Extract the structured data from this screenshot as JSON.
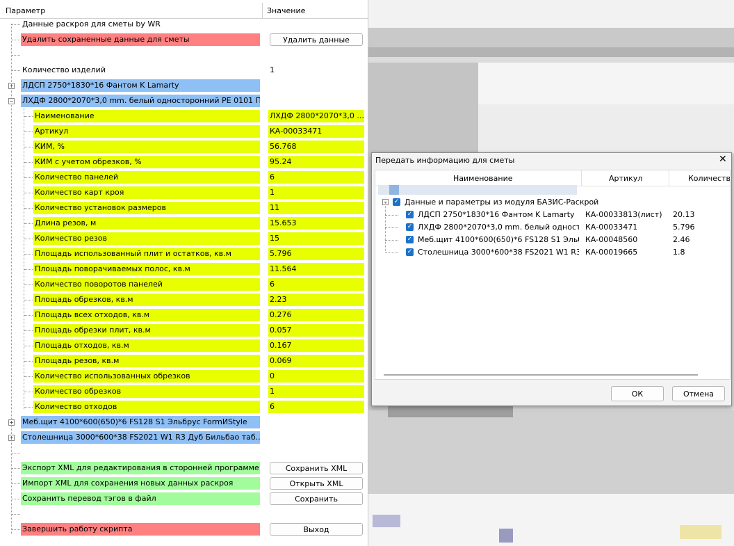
{
  "panel": {
    "col_param": "Параметр",
    "col_value": "Значение",
    "title_row": "Данные раскроя для сметы by WR",
    "delete_saved": {
      "label": "Удалить сохраненные данные для сметы",
      "button": "Удалить данные"
    },
    "count_items": {
      "label": "Количество изделий",
      "value": "1"
    },
    "materials": [
      {
        "label": "ЛДСП 2750*1830*16 Фантом K Lamarty",
        "expander": "+"
      },
      {
        "label": "ЛХДФ 2800*2070*3,0 mm. белый односторонний PE 0101 П",
        "expander": "−"
      },
      {
        "label": "Меб.щит 4100*600(650)*6 FS128 S1 Эльбрус FormИStyle",
        "expander": "+"
      },
      {
        "label": "Столешница 3000*600*38 FS2021 W1 R3 Дуб Бильбао таб...",
        "expander": "+"
      }
    ],
    "props": [
      {
        "label": "Наименование",
        "value": "ЛХДФ 2800*2070*3,0 ..."
      },
      {
        "label": "Артикул",
        "value": "КА-00033471"
      },
      {
        "label": "КИМ, %",
        "value": "56.768"
      },
      {
        "label": "КИМ с учетом обрезков, %",
        "value": "95.24"
      },
      {
        "label": "Количество панелей",
        "value": "6"
      },
      {
        "label": "Количество карт кроя",
        "value": "1"
      },
      {
        "label": "Количество установок размеров",
        "value": "11"
      },
      {
        "label": "Длина резов, м",
        "value": "15.653"
      },
      {
        "label": "Количество резов",
        "value": "15"
      },
      {
        "label": "Площадь использованный плит и остатков, кв.м",
        "value": "5.796"
      },
      {
        "label": "Площадь поворачиваемых полос, кв.м",
        "value": "11.564"
      },
      {
        "label": "Количество поворотов панелей",
        "value": "6"
      },
      {
        "label": "Площадь обрезков, кв.м",
        "value": "2.23"
      },
      {
        "label": "Площадь всех отходов, кв.м",
        "value": "0.276"
      },
      {
        "label": "Площадь обрезки плит, кв.м",
        "value": "0.057"
      },
      {
        "label": "Площадь отходов, кв.м",
        "value": "0.167"
      },
      {
        "label": "Площадь резов, кв.м",
        "value": "0.069"
      },
      {
        "label": "Количество использованных обрезков",
        "value": "0"
      },
      {
        "label": "Количество обрезков",
        "value": "1"
      },
      {
        "label": "Количество отходов",
        "value": "6"
      }
    ],
    "export_xml": {
      "label": "Экспорт XML для редактирования в сторонней программе",
      "button": "Сохранить XML"
    },
    "import_xml": {
      "label": "Импорт XML для сохранения новых данных раскроя",
      "button": "Открыть XML"
    },
    "save_tags": {
      "label": "Сохранить перевод тэгов в файл",
      "button": "Сохранить"
    },
    "finish": {
      "label": "Завершить работу скрипта",
      "button": "Выход"
    }
  },
  "dialog": {
    "title": "Передать информацию для сметы",
    "close_glyph": "✕",
    "columns": [
      "Наименование",
      "Артикул",
      "Количество"
    ],
    "root": "Данные и параметры из модуля БАЗИС-Раскрой",
    "items": [
      {
        "name": "ЛДСП 2750*1830*16 Фантом K Lamarty",
        "article": "КА-00033813(лист)",
        "qty": "20.13"
      },
      {
        "name": "ЛХДФ 2800*2070*3,0 mm. белый односто...",
        "article": "КА-00033471",
        "qty": "5.796"
      },
      {
        "name": "Меб.щит 4100*600(650)*6 FS128 S1 Эльб...",
        "article": "КА-00048560",
        "qty": "2.46"
      },
      {
        "name": "Столешница 3000*600*38 FS2021 W1 R3 ...",
        "article": "КА-00019665",
        "qty": "1.8"
      }
    ],
    "ok": "ОК",
    "cancel": "Отмена"
  },
  "colors": {
    "red": "#ff8080",
    "blue": "#8ebff5",
    "yellow": "#e8ff00",
    "green": "#a2fc9c",
    "checkbox": "#1a73c8"
  }
}
